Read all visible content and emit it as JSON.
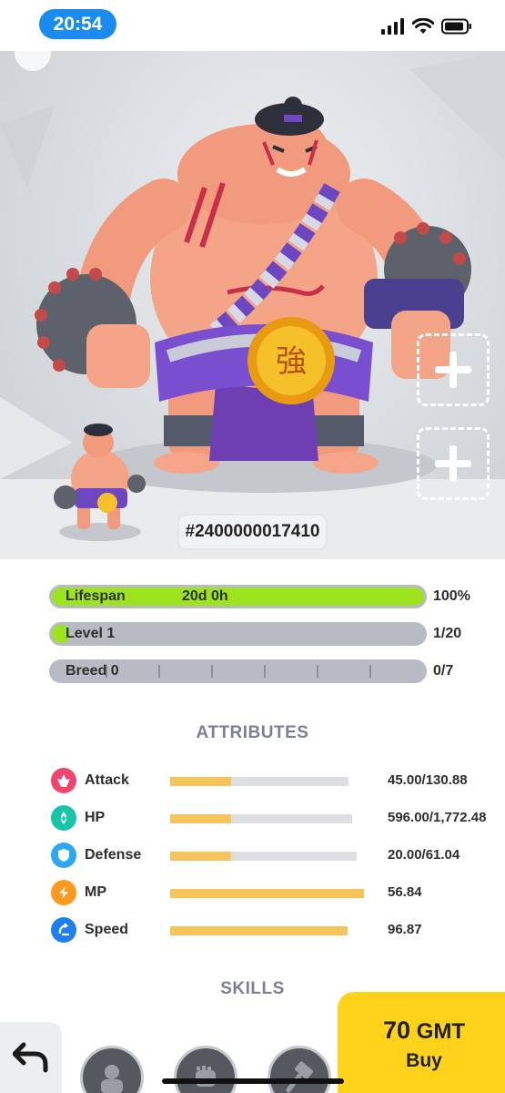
{
  "status_bar": {
    "time": "20:54"
  },
  "hero": {
    "token_id": "#2400000017410"
  },
  "stats": [
    {
      "label": "Lifespan",
      "middle": "20d 0h",
      "value": "100%",
      "fill": 1.0
    },
    {
      "label": "Level 1",
      "middle": "",
      "value": "1/20",
      "fill": 0.05
    },
    {
      "label": "Breed 0",
      "middle": "",
      "value": "0/7",
      "fill": 0.0
    }
  ],
  "attributes_title": "ATTRIBUTES",
  "attributes": [
    {
      "name": "Attack",
      "value": "45.00/130.88",
      "fill": 0.34,
      "icon": "attack-icon",
      "color": "#f2456e"
    },
    {
      "name": "HP",
      "value": "596.00/1,772.48",
      "fill": 0.34,
      "icon": "hp-icon",
      "color": "#19c4a7"
    },
    {
      "name": "Defense",
      "value": "20.00/61.04",
      "fill": 0.33,
      "icon": "defense-icon",
      "color": "#2ea7f2"
    },
    {
      "name": "MP",
      "value": "56.84",
      "fill": 1.0,
      "icon": "mp-icon",
      "color": "#ff9a1f"
    },
    {
      "name": "Speed",
      "value": "96.87",
      "fill": 1.0,
      "icon": "speed-icon",
      "color": "#1f7ff0"
    }
  ],
  "skills_title": "SKILLS",
  "buy": {
    "amount": "70",
    "currency": "GMT",
    "label": "Buy"
  },
  "colors": {
    "accent_blue": "#1a8cf0",
    "lifespan_green": "#9ee41e",
    "buy_yellow": "#ffd21b",
    "attr_fill": "#f7c35b"
  }
}
